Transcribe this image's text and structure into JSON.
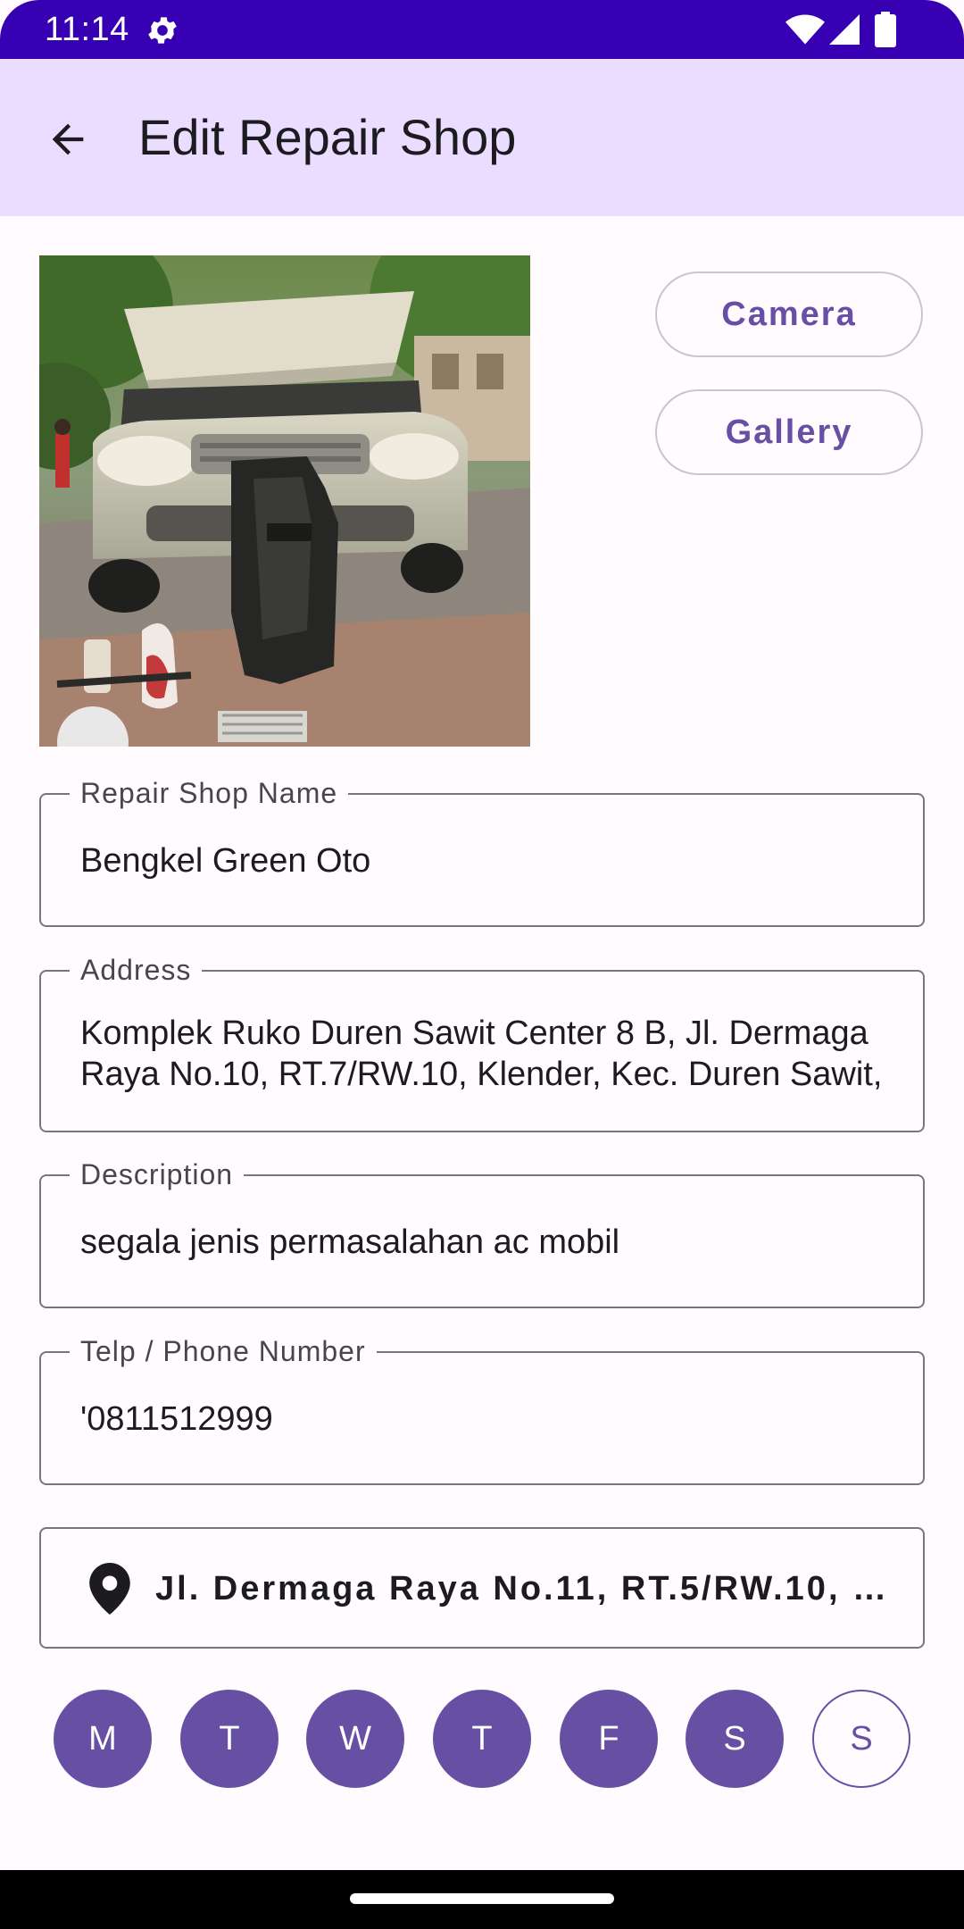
{
  "status_bar": {
    "time": "11:14",
    "icons": [
      "gear-icon",
      "wifi-icon",
      "signal-icon",
      "battery-icon"
    ]
  },
  "app_bar": {
    "back_icon": "arrow-back-icon",
    "title": "Edit Repair Shop"
  },
  "photo": {
    "subject": "car-repair-photo"
  },
  "buttons": {
    "camera": "Camera",
    "gallery": "Gallery"
  },
  "fields": {
    "name": {
      "label": "Repair Shop Name",
      "value": "Bengkel Green Oto"
    },
    "address": {
      "label": "Address",
      "value": "Komplek Ruko Duren Sawit Center 8 B, Jl. Dermaga Raya No.10, RT.7/RW.10, Klender, Kec. Duren Sawit,"
    },
    "description": {
      "label": "Description",
      "value": "segala jenis permasalahan ac mobil"
    },
    "phone": {
      "label": "Telp / Phone Number",
      "value": "'0811512999"
    }
  },
  "location": {
    "icon": "location-pin-icon",
    "text": "Jl. Dermaga Raya No.11, RT.5/RW.10, …"
  },
  "days": [
    {
      "label": "M",
      "selected": true
    },
    {
      "label": "T",
      "selected": true
    },
    {
      "label": "W",
      "selected": true
    },
    {
      "label": "T",
      "selected": true
    },
    {
      "label": "F",
      "selected": true
    },
    {
      "label": "S",
      "selected": true
    },
    {
      "label": "S",
      "selected": false
    }
  ],
  "colors": {
    "status_bar": "#3700b3",
    "app_bar": "#eaddff",
    "primary": "#6750a4",
    "outline": "#79747e",
    "background": "#fffbfe"
  }
}
